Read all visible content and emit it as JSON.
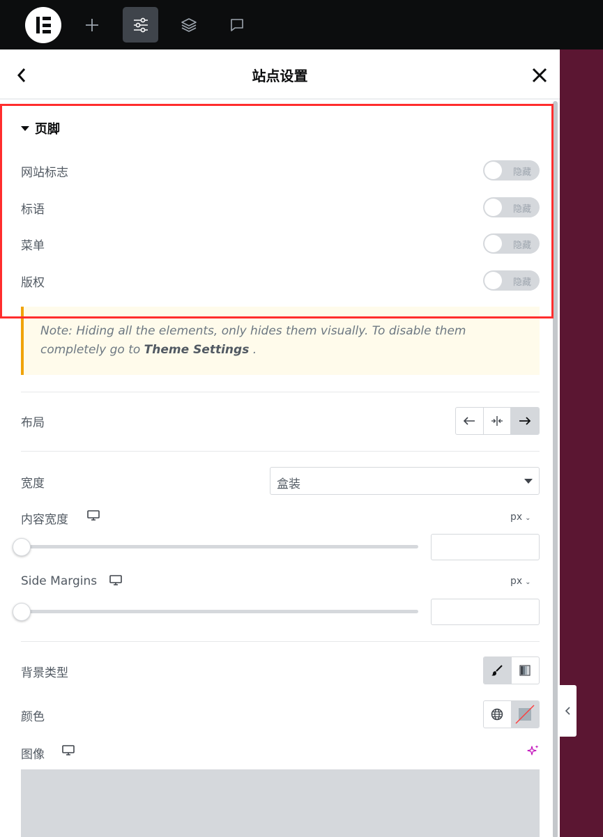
{
  "topbar": {
    "items": [
      {
        "name": "elementor-logo",
        "active": false
      },
      {
        "name": "add-element",
        "icon": "plus-icon",
        "active": false
      },
      {
        "name": "site-settings",
        "icon": "sliders-icon",
        "active": true
      },
      {
        "name": "structure",
        "icon": "layers-icon",
        "active": false
      },
      {
        "name": "comments",
        "icon": "chat-icon",
        "active": false
      }
    ]
  },
  "panel": {
    "title": "站点设置",
    "back_icon": "chevron-left-icon",
    "close_icon": "close-icon"
  },
  "footer_section": {
    "title": "页脚",
    "toggles": [
      {
        "label": "网站标志",
        "state_text": "隐藏"
      },
      {
        "label": "标语",
        "state_text": "隐藏"
      },
      {
        "label": "菜单",
        "state_text": "隐藏"
      },
      {
        "label": "版权",
        "state_text": "隐藏"
      }
    ],
    "note_text": "Note: Hiding all the elements, only hides them visually. To disable them completely go to",
    "note_link": "Theme Settings",
    "note_end": " ."
  },
  "layout": {
    "label": "布局",
    "options": [
      "arrow-left-icon",
      "align-center-icon",
      "arrow-right-icon"
    ],
    "selected_index": 2
  },
  "width": {
    "label": "宽度",
    "value": "盒装"
  },
  "content_width": {
    "label": "内容宽度",
    "unit": "px",
    "value": ""
  },
  "side_margins": {
    "label": "Side Margins",
    "unit": "px",
    "value": ""
  },
  "background_type": {
    "label": "背景类型",
    "options": [
      "brush-icon",
      "gradient-icon"
    ],
    "selected_index": 0
  },
  "color": {
    "label": "颜色"
  },
  "image": {
    "label": "图像",
    "ai_icon": "sparkle-icon"
  },
  "colors": {
    "accent_red": "#ff2d2d",
    "note_border": "#f0a30a",
    "preview_bg": "#5b1632"
  }
}
